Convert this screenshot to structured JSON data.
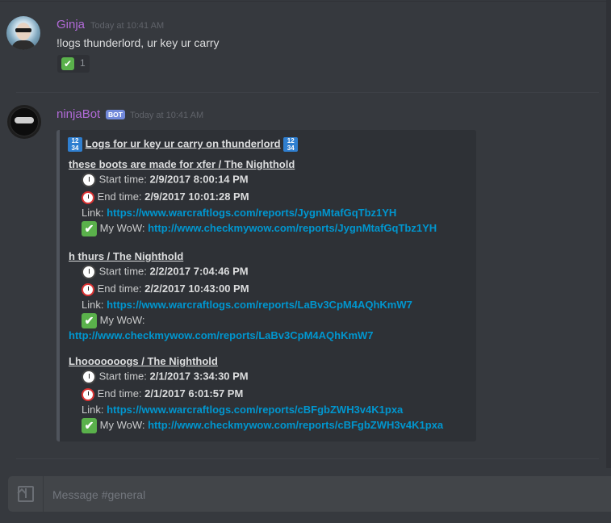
{
  "messages": {
    "first": {
      "author": "Ginja",
      "timestamp": "Today at 10:41 AM",
      "text": "!logs thunderlord, ur key ur carry",
      "reaction": {
        "emoji": "✔",
        "count": "1"
      }
    },
    "second": {
      "author": "ninjaBot",
      "badge": "BOT",
      "timestamp": "Today at 10:41 AM"
    }
  },
  "embed": {
    "title_icon": "1234-icon",
    "title": "Logs for ur key ur carry on thunderlord",
    "entries": [
      {
        "heading": "these boots are made for xfer / The Nighthold",
        "start_label": "Start time:",
        "start": "2/9/2017 8:00:14 PM",
        "end_label": "End time:",
        "end": "2/9/2017 10:01:28 PM",
        "link_label": "Link:",
        "link": "https://www.warcraftlogs.com/reports/JygnMtafGqTbz1YH",
        "wow_label": "My WoW:",
        "wow": "http://www.checkmywow.com/reports/JygnMtafGqTbz1YH"
      },
      {
        "heading": "h thurs / The Nighthold",
        "start_label": "Start time:",
        "start": "2/2/2017 7:04:46 PM",
        "end_label": "End time:",
        "end": "2/2/2017 10:43:00 PM",
        "link_label": "Link:",
        "link": "https://www.warcraftlogs.com/reports/LaBv3CpM4AQhKmW7",
        "wow_label": "My WoW:",
        "wow": "http://www.checkmywow.com/reports/LaBv3CpM4AQhKmW7"
      },
      {
        "heading": "Lhooooooogs / The Nighthold",
        "start_label": "Start time:",
        "start": "2/1/2017 3:34:30 PM",
        "end_label": "End time:",
        "end": "2/1/2017 6:01:57 PM",
        "link_label": "Link:",
        "link": "https://www.warcraftlogs.com/reports/cBFgbZWH3v4K1pxa",
        "wow_label": "My WoW:",
        "wow": "http://www.checkmywow.com/reports/cBFgbZWH3v4K1pxa"
      }
    ]
  },
  "composer": {
    "placeholder": "Message #general",
    "upload_icon": "upload-icon"
  },
  "colors": {
    "background": "#36393e",
    "username": "#b06ad6",
    "link": "#0096cf",
    "bot_badge": "#7289da"
  }
}
